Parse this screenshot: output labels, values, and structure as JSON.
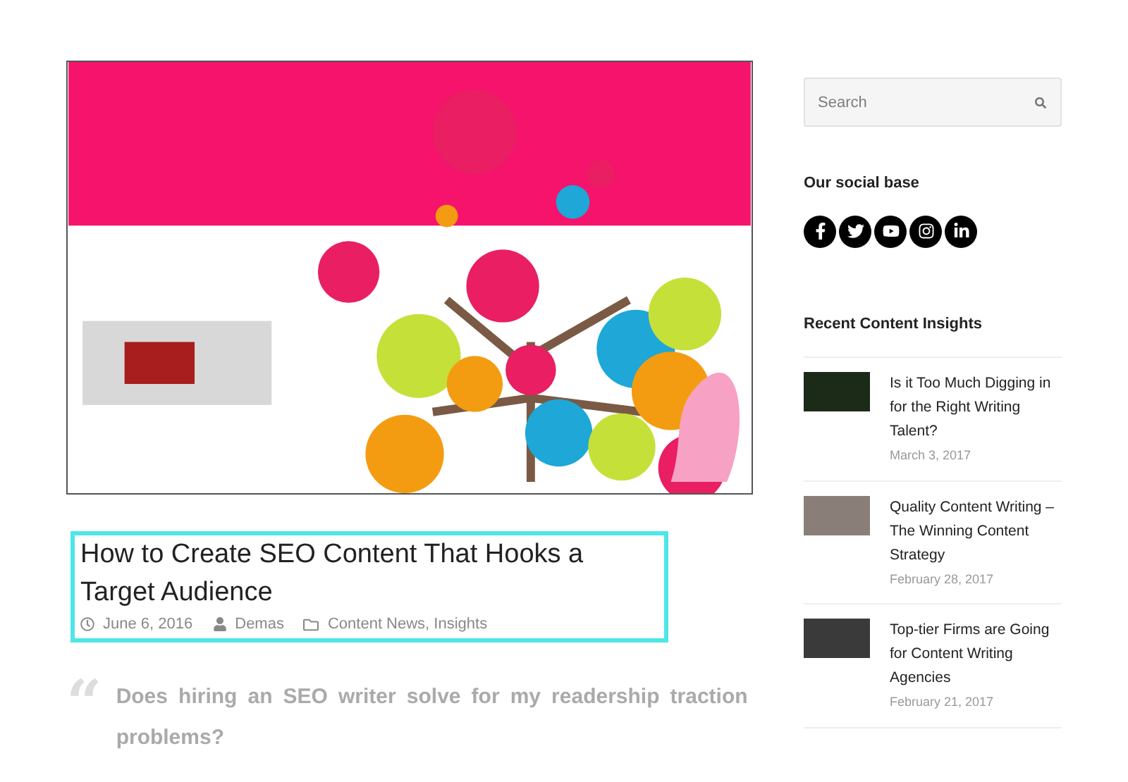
{
  "post": {
    "title": "How to Create SEO Content That Hooks a Target Audience",
    "date": "June 6, 2016",
    "author": "Demas",
    "categories": "Content News, Insights",
    "quote_mark": "“",
    "quote": "Does hiring an SEO writer solve for my readership traction problems?"
  },
  "sidebar": {
    "search": {
      "placeholder": "Search"
    },
    "social_heading": "Our social base",
    "social_links": [
      {
        "kind": "facebook"
      },
      {
        "kind": "twitter"
      },
      {
        "kind": "youtube"
      },
      {
        "kind": "instagram"
      },
      {
        "kind": "linkedin"
      }
    ],
    "recent_heading": "Recent Content Insights",
    "recent_posts": [
      {
        "title": "Is it Too Much Digging in for the Right Writing Talent?",
        "date": "March 3, 2017",
        "kind": "dark"
      },
      {
        "title": "Quality Content Writing – The Winning Content Strategy",
        "date": "February 28, 2017",
        "kind": "desk"
      },
      {
        "title": "Top-tier Firms are Going for Content Writing Agencies",
        "date": "February 21, 2017",
        "kind": "board"
      }
    ]
  }
}
